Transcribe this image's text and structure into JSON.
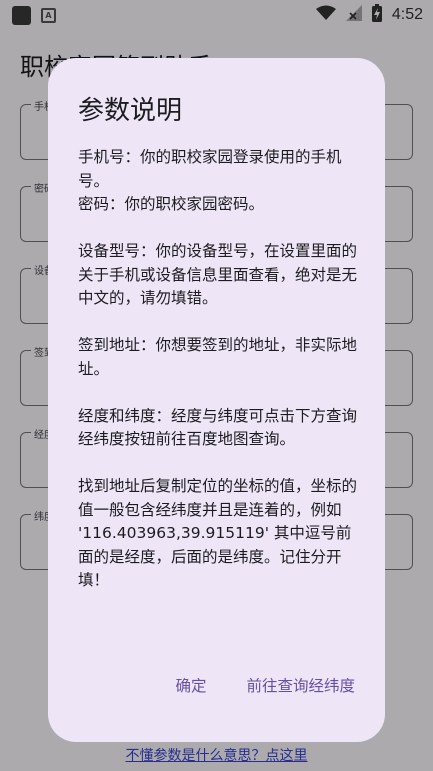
{
  "status_bar": {
    "time": "4:52",
    "notification_a": "A",
    "icons": [
      "wifi-icon",
      "signal-icon",
      "battery-charging-icon"
    ]
  },
  "page": {
    "title": "职校家园签到助手",
    "fields": [
      {
        "label": "手机号"
      },
      {
        "label": "密码"
      },
      {
        "label": "设备型号"
      },
      {
        "label": "签到地址"
      },
      {
        "label": "经度"
      },
      {
        "label": "纬度"
      }
    ],
    "help_link": "不懂参数是什么意思？点这里"
  },
  "dialog": {
    "title": "参数说明",
    "paragraphs": [
      "手机号：你的职校家园登录使用的手机号。",
      "密码：你的职校家园密码。",
      "",
      "设备型号：你的设备型号，在设置里面的关于手机或设备信息里面查看，绝对是无中文的，请勿填错。",
      "",
      "签到地址：你想要签到的地址，非实际地址。",
      "",
      "经度和纬度：经度与纬度可点击下方查询经纬度按钮前往百度地图查询。",
      "",
      "找到地址后复制定位的坐标的值，坐标的值一般包含经纬度并且是连着的，例如 '116.403963,39.915119' 其中逗号前面的是经度，后面的是纬度。记住分开填！"
    ],
    "confirm_label": "确定",
    "lookup_label": "前往查询经纬度"
  },
  "colors": {
    "accent": "#6750a4",
    "dialog_bg": "#eee6f6",
    "link": "#3a45d4"
  }
}
